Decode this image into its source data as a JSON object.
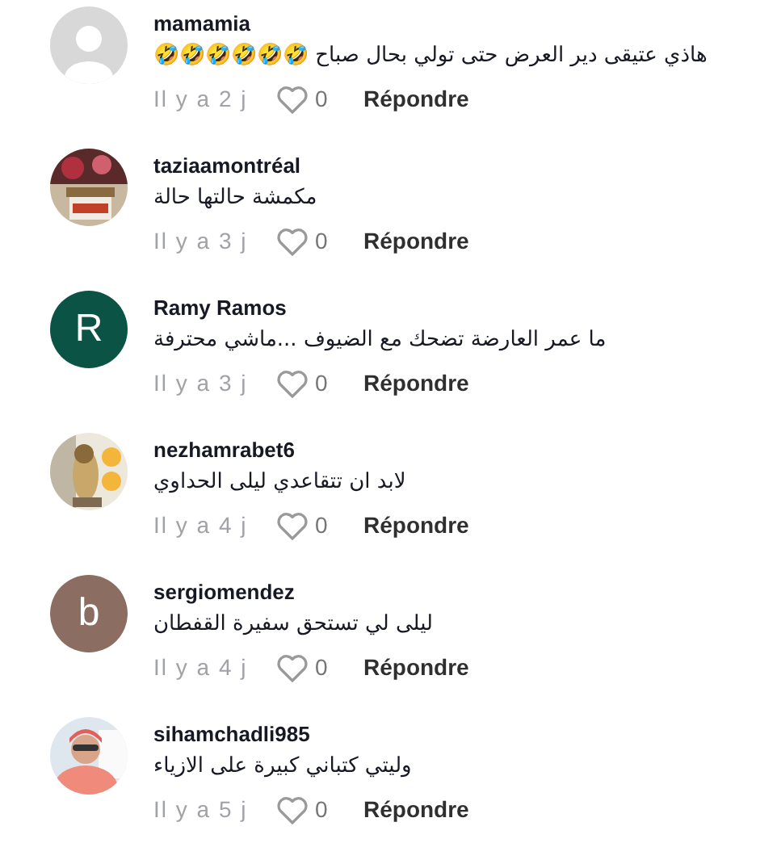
{
  "comments": [
    {
      "avatar": {
        "kind": "default"
      },
      "username": "mamamia",
      "text": "هاذي عتيقى دير العرض حتى تولي بحال صباح 🤣🤣🤣🤣🤣🤣",
      "time": "Il y a 2 j",
      "likes": "0",
      "reply": "Répondre"
    },
    {
      "username": "taziaamontréal",
      "text": "مكمشة حالتها حالة",
      "time": "Il y a 3 j",
      "likes": "0",
      "reply": "Répondre"
    },
    {
      "avatar": {
        "kind": "letter",
        "letter": "R",
        "color": "#0b5345"
      },
      "username": "Ramy Ramos",
      "text": "ما عمر العارضة تضحك مع الضيوف ...ماشي محترفة",
      "time": "Il y a 3 j",
      "likes": "0",
      "reply": "Répondre"
    },
    {
      "username": "nezhamrabet6",
      "text": "لابد ان تتقاعدي ليلى الحداوي",
      "time": "Il y a 4 j",
      "likes": "0",
      "reply": "Répondre"
    },
    {
      "avatar": {
        "kind": "letter",
        "letter": "b",
        "color": "#8c6d62"
      },
      "username": "sergiomendez",
      "text": "ليلى لي تستحق سفيرة القفطان",
      "time": "Il y a 4 j",
      "likes": "0",
      "reply": "Répondre"
    },
    {
      "username": "sihamchadli985",
      "text": "وليتي كتباني كبيرة على الازياء",
      "time": "Il y a 5 j",
      "likes": "0",
      "reply": "Répondre"
    }
  ]
}
